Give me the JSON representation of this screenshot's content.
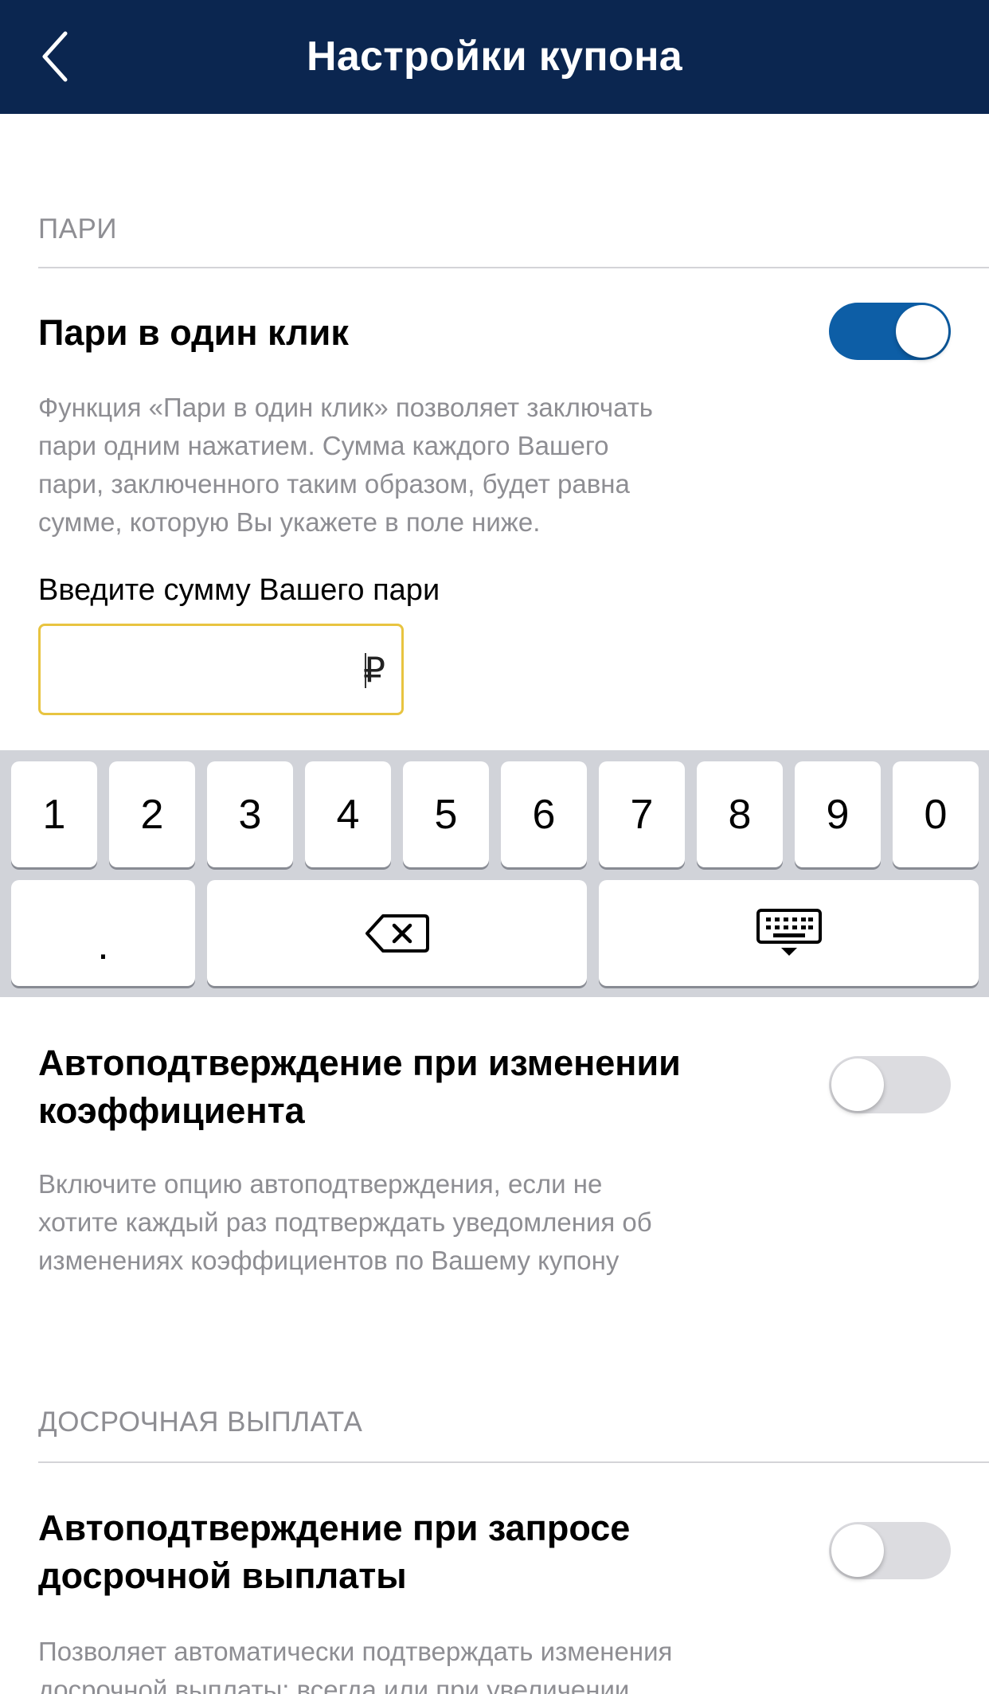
{
  "header": {
    "title": "Настройки купона",
    "back_icon": "chevron-left-icon"
  },
  "sections": {
    "pari_label": "ПАРИ",
    "early_label": "ДОСРОЧНАЯ ВЫПЛАТА"
  },
  "one_click": {
    "title": "Пари в один клик",
    "toggle_on": true,
    "desc_lines": [
      "Функция «Пари в один клик» позволяет заключать",
      "пари одним нажатием. Сумма каждого Вашего",
      "пари, заключенного таким образом, будет равна",
      "сумме, которую Вы укажете в поле ниже."
    ],
    "amount_label": "Введите сумму Вашего пари",
    "amount_value": "",
    "currency": "₽"
  },
  "keyboard": {
    "digits": [
      "1",
      "2",
      "3",
      "4",
      "5",
      "6",
      "7",
      "8",
      "9",
      "0"
    ],
    "dot": ".",
    "backspace_icon": "backspace-icon",
    "hide_icon": "keyboard-hide-icon"
  },
  "auto_odds": {
    "title_lines": [
      "Автоподтверждение при изменении",
      "коэффициента"
    ],
    "toggle_on": false,
    "desc_lines": [
      "Включите опцию автоподтверждения, если не",
      "хотите каждый раз подтверждать уведомления об",
      "изменениях коэффициентов по Вашему купону"
    ]
  },
  "auto_early": {
    "title_lines": [
      "Автоподтверждение при запросе",
      "досрочной выплаты"
    ],
    "toggle_on": false,
    "desc_lines": [
      "Позволяет автоматически подтверждать изменения",
      "досрочной выплаты: всегда или при увеличении"
    ]
  },
  "colors": {
    "header_bg": "#0b2650",
    "toggle_on": "#0d5ea6",
    "toggle_off": "#dcdce0",
    "field_border": "#e8c440",
    "keyboard_bg": "#d1d3d9"
  }
}
